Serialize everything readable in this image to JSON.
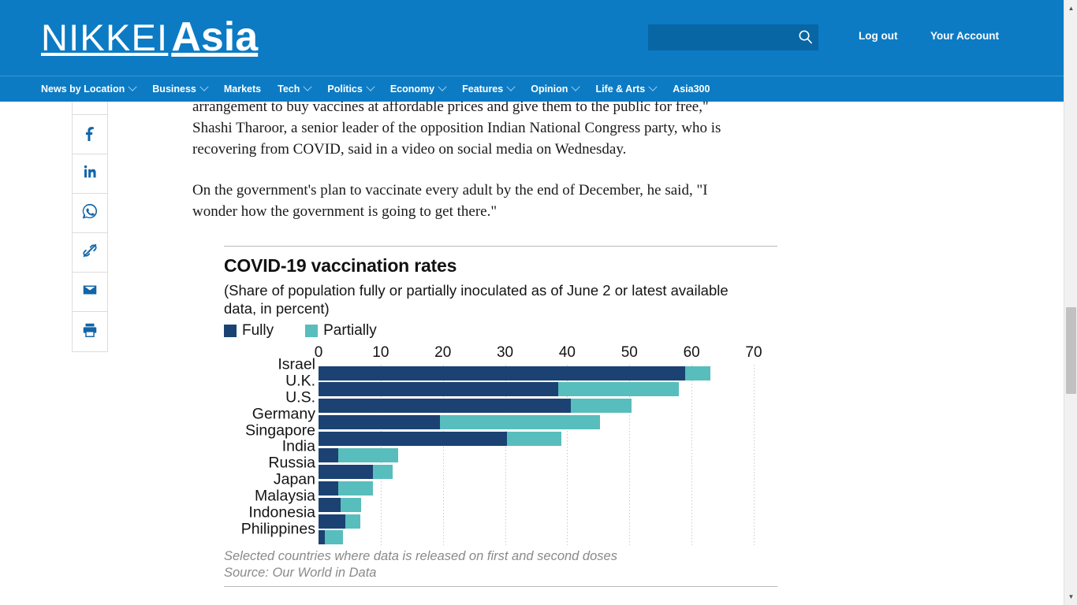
{
  "site": {
    "brand_primary": "NIKKEI",
    "brand_secondary": "Asia",
    "header_color": "#0c7bc4"
  },
  "header": {
    "search_value": "",
    "search_placeholder": "",
    "search_icon": "search-icon",
    "logout_label": "Log out",
    "account_label": "Your Account"
  },
  "nav": {
    "items": [
      {
        "label": "News by Location",
        "has_caret": true
      },
      {
        "label": "Business",
        "has_caret": true
      },
      {
        "label": "Markets",
        "has_caret": false
      },
      {
        "label": "Tech",
        "has_caret": true
      },
      {
        "label": "Politics",
        "has_caret": true
      },
      {
        "label": "Economy",
        "has_caret": true
      },
      {
        "label": "Features",
        "has_caret": true
      },
      {
        "label": "Opinion",
        "has_caret": true
      },
      {
        "label": "Life & Arts",
        "has_caret": true
      },
      {
        "label": "Asia300",
        "has_caret": false
      }
    ]
  },
  "share_rail": {
    "items": [
      {
        "icon": "facebook-icon",
        "label": "Share on Facebook"
      },
      {
        "icon": "linkedin-icon",
        "label": "Share on LinkedIn"
      },
      {
        "icon": "whatsapp-icon",
        "label": "Share on WhatsApp"
      },
      {
        "icon": "link-icon",
        "label": "Copy link"
      },
      {
        "icon": "email-icon",
        "label": "Share by email"
      },
      {
        "icon": "print-icon",
        "label": "Print"
      }
    ]
  },
  "article": {
    "paragraphs": [
      "arrangement to buy vaccines at affordable prices and give them to the public for free,\" Shashi Tharoor, a senior leader of the opposition Indian National Congress party, who is recovering from COVID, said in a video on social media on Wednesday.",
      "On the government's plan to vaccinate every adult by the end of December, he said, \"I wonder how the government is going to get there.\""
    ]
  },
  "chart_data": {
    "type": "bar",
    "orientation": "horizontal",
    "stacked": true,
    "title": "COVID-19 vaccination rates",
    "subtitle": "(Share of population fully or partially inoculated as of June 2 or latest available data, in percent)",
    "xlabel": "",
    "ylabel": "",
    "xlim": [
      0,
      70
    ],
    "xticks": [
      0,
      10,
      20,
      30,
      40,
      50,
      60,
      70
    ],
    "grid": true,
    "legend_position": "top-left",
    "categories": [
      "Israel",
      "U.K.",
      "U.S.",
      "Germany",
      "Singapore",
      "India",
      "Russia",
      "Japan",
      "Malaysia",
      "Indonesia",
      "Philippines"
    ],
    "series": [
      {
        "name": "Fully",
        "color": "#1b4272",
        "values": [
          59.0,
          38.5,
          40.6,
          19.5,
          30.3,
          3.2,
          8.8,
          3.2,
          3.5,
          4.3,
          1.0
        ]
      },
      {
        "name": "Partially",
        "color": "#58bdbd",
        "values": [
          4.0,
          19.5,
          9.8,
          25.8,
          8.7,
          9.6,
          3.1,
          5.5,
          3.4,
          2.4,
          2.9
        ]
      }
    ],
    "totals": [
      63.0,
      58.0,
      50.4,
      45.3,
      39.0,
      12.8,
      11.9,
      8.7,
      6.9,
      6.7,
      3.9
    ],
    "footnotes": [
      "Selected countries where data is released on first and second doses",
      "Source: Our World in Data"
    ]
  },
  "scrollbar": {
    "up_arrow": "▲",
    "down_arrow": "▼"
  }
}
